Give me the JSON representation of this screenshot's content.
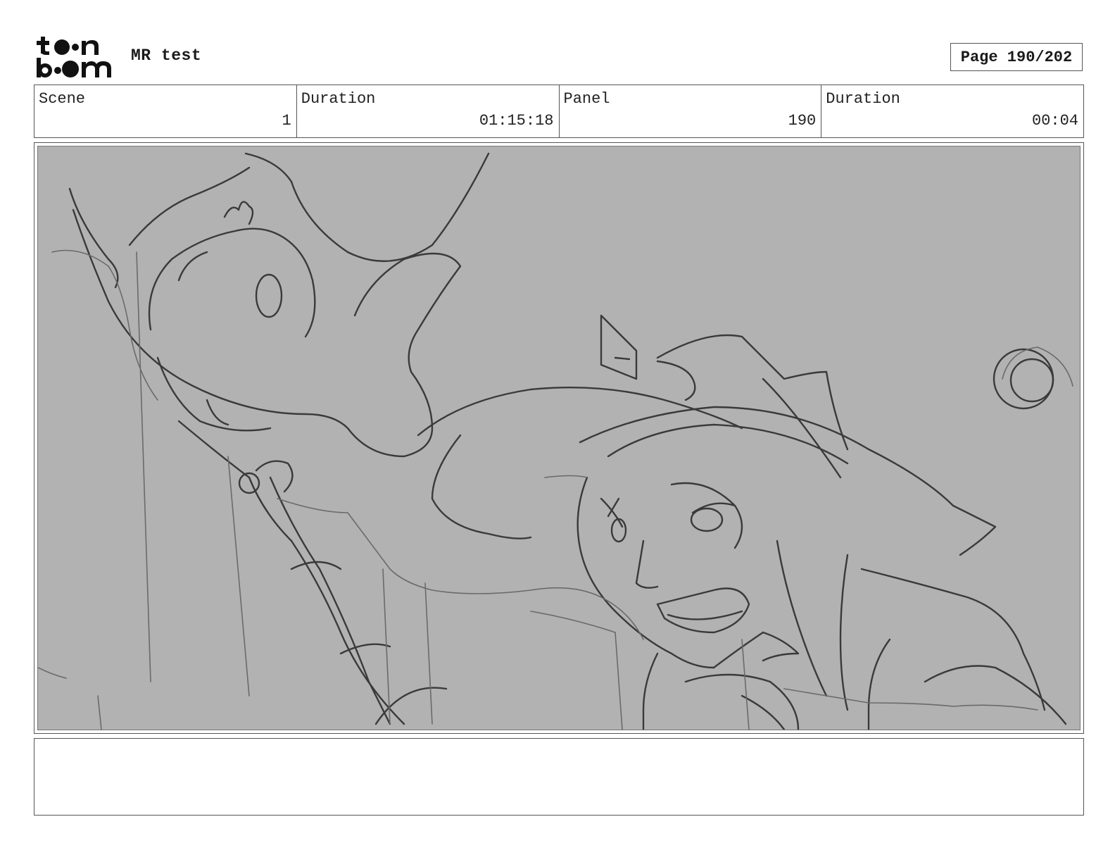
{
  "header": {
    "logo_top": "t●●n",
    "logo_bottom": "b●●m",
    "project_title": "MR test",
    "page_label": "Page 190/202"
  },
  "info": [
    {
      "label": "Scene",
      "value": "1"
    },
    {
      "label": "Duration",
      "value": "01:15:18"
    },
    {
      "label": "Panel",
      "value": "190"
    },
    {
      "label": "Duration",
      "value": "00:04"
    }
  ],
  "panel": {
    "background": "#b2b2b2",
    "sketch_stroke": "#3a3a3a"
  },
  "notes": {
    "text": ""
  }
}
